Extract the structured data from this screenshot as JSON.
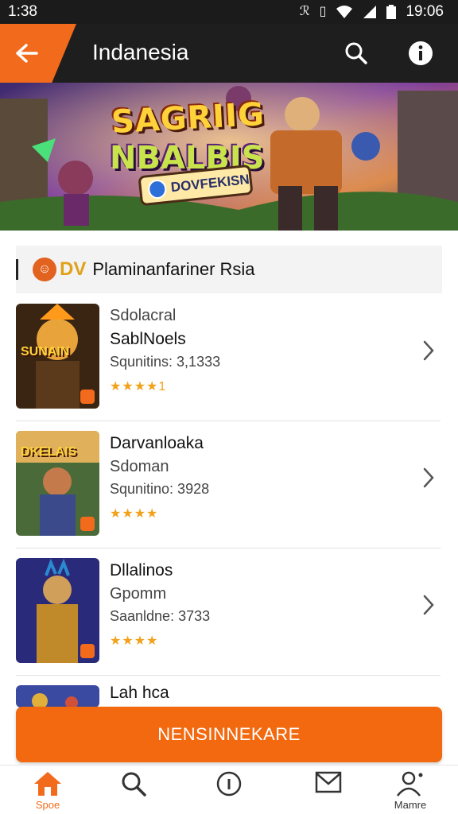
{
  "status_bar": {
    "time_left": "1:38",
    "time_right": "19:06",
    "icons": [
      "nfc-icon",
      "vibrate-icon",
      "wifi-icon",
      "signal-icon",
      "battery-icon"
    ]
  },
  "app_bar": {
    "title": "Indanesia",
    "back_icon": "arrow-left-icon",
    "search_icon": "search-icon",
    "info_icon": "info-icon"
  },
  "banner": {
    "title": "SAGRIIG",
    "subtitle": "NBALBJS",
    "pill_text": "DOVFEKISN"
  },
  "section": {
    "logo_text": "DV",
    "title": "Plaminanfariner Rsia"
  },
  "games": [
    {
      "line1": "Sdolacral",
      "line2": "SablNoels",
      "line3": "Squnitins: 3,1333",
      "stars": "★★★★1",
      "thumb_label": "SUNAIN"
    },
    {
      "line1": "Darvanloaka",
      "line2": "Sdoman",
      "line3": "Squnitino: 3928",
      "stars": "★★★★",
      "thumb_label": "DKELAIS"
    },
    {
      "line1": "Dllalinos",
      "line2": "Gpomm",
      "line3": "Saanldne: 3733",
      "stars": "★★★★",
      "thumb_label": ""
    }
  ],
  "partial_row": {
    "line1": "Lah hca"
  },
  "cta": {
    "label": "NENSINNEKARE"
  },
  "bottom_nav": [
    {
      "label": "Spoe",
      "icon": "home-icon"
    },
    {
      "label": "",
      "icon": "search-icon"
    },
    {
      "label": "",
      "icon": "info-circle-icon"
    },
    {
      "label": "",
      "icon": "mail-icon"
    },
    {
      "label": "Mamre",
      "icon": "profile-icon"
    }
  ],
  "colors": {
    "accent": "#f26a1b",
    "app_bar": "#1e1e1e",
    "status_bar": "#1b1b1b",
    "stars": "#f1a21a"
  }
}
